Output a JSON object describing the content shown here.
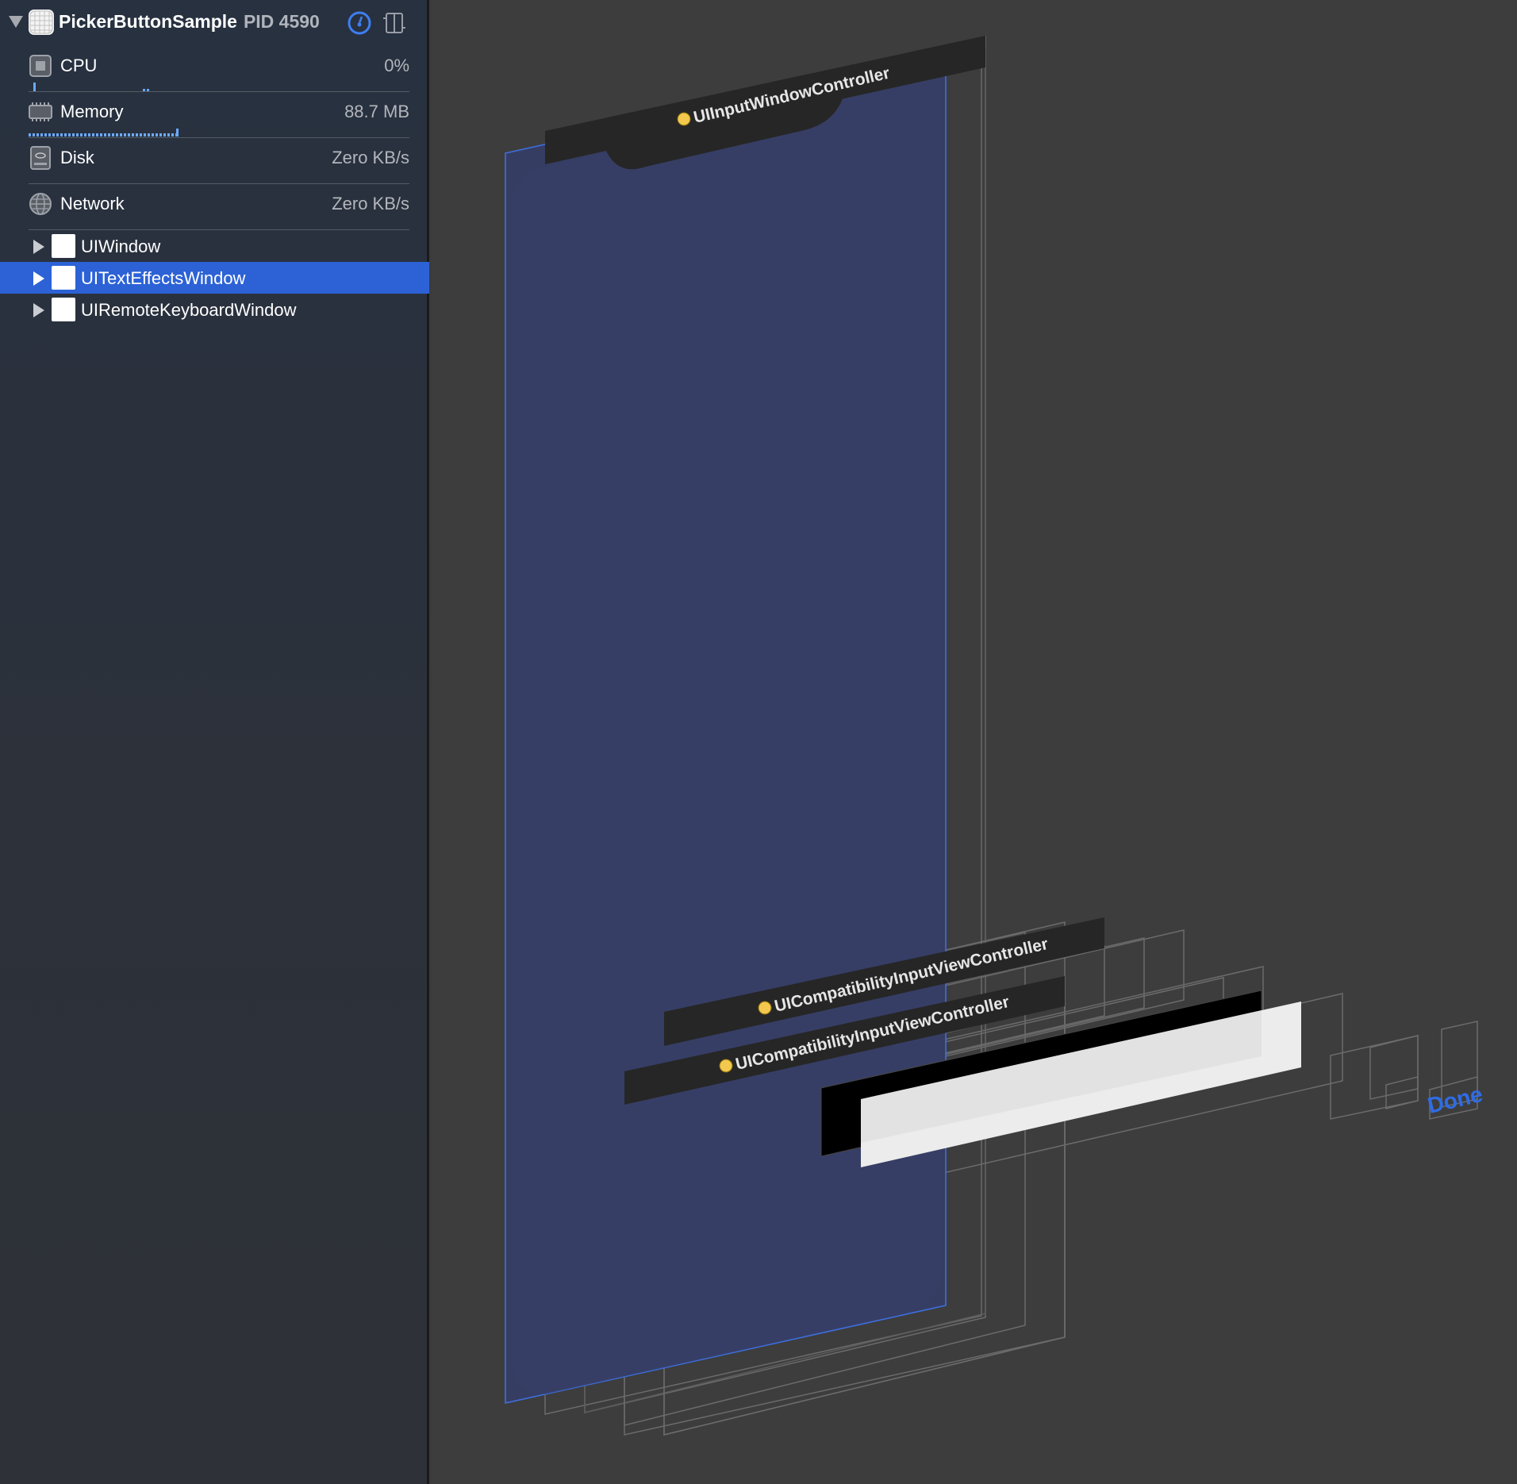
{
  "process": {
    "name": "PickerButtonSample",
    "pid": "PID 4590"
  },
  "metrics": [
    {
      "label": "CPU",
      "value": "0%",
      "icon": "cpu-icon"
    },
    {
      "label": "Memory",
      "value": "88.7 MB",
      "icon": "memory-icon"
    },
    {
      "label": "Disk",
      "value": "Zero KB/s",
      "icon": "disk-icon"
    },
    {
      "label": "Network",
      "value": "Zero KB/s",
      "icon": "network-icon"
    }
  ],
  "tree": [
    {
      "label": "UIWindow",
      "selected": false
    },
    {
      "label": "UITextEffectsWindow",
      "selected": true
    },
    {
      "label": "UIRemoteKeyboardWindow",
      "selected": false
    }
  ],
  "canvas": {
    "input_window_controller": "UIInputWindowController",
    "compat_controller_1": "UICompatibilityInputViewController",
    "compat_controller_2": "UICompatibilityInputViewController",
    "done_label": "Done"
  },
  "colors": {
    "selection": "#2c62d6",
    "accent_blue": "#2f6ce5",
    "view_fill": "#363d63",
    "canvas_bg": "#3d3d3d"
  }
}
